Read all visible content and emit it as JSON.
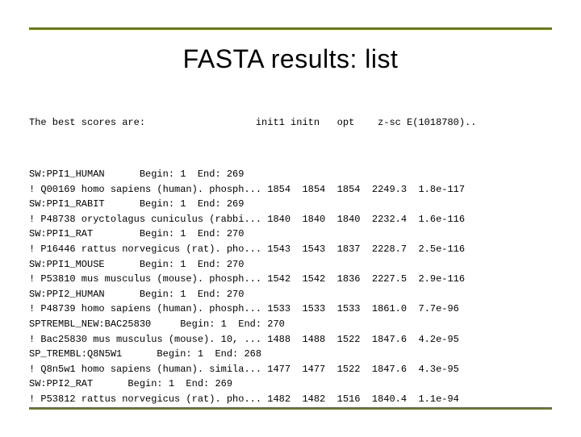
{
  "title": "FASTA results: list",
  "header_line": "The best scores are:                   init1 initn   opt    z-sc E(1018780)..",
  "entries": [
    {
      "seq_line": "SW:PPI1_HUMAN      Begin: 1  End: 269",
      "data_line": "! Q00169 homo sapiens (human). phosph... 1854  1854  1854  2249.3  1.8e-117"
    },
    {
      "seq_line": "SW:PPI1_RABIT      Begin: 1  End: 269",
      "data_line": "! P48738 oryctolagus cuniculus (rabbi... 1840  1840  1840  2232.4  1.6e-116"
    },
    {
      "seq_line": "SW:PPI1_RAT        Begin: 1  End: 270",
      "data_line": "! P16446 rattus norvegicus (rat). pho... 1543  1543  1837  2228.7  2.5e-116"
    },
    {
      "seq_line": "SW:PPI1_MOUSE      Begin: 1  End: 270",
      "data_line": "! P53810 mus musculus (mouse). phosph... 1542  1542  1836  2227.5  2.9e-116"
    },
    {
      "seq_line": "SW:PPI2_HUMAN      Begin: 1  End: 270",
      "data_line": "! P48739 homo sapiens (human). phosph... 1533  1533  1533  1861.0  7.7e-96"
    },
    {
      "seq_line": "SPTREMBL_NEW:BAC25830     Begin: 1  End: 270",
      "data_line": "! Bac25830 mus musculus (mouse). 10, ... 1488  1488  1522  1847.6  4.2e-95"
    },
    {
      "seq_line": "SP_TREMBL:Q8N5W1      Begin: 1  End: 268",
      "data_line": "! Q8n5w1 homo sapiens (human). simila... 1477  1477  1522  1847.6  4.3e-95"
    },
    {
      "seq_line": "SW:PPI2_RAT      Begin: 1  End: 269",
      "data_line": "! P53812 rattus norvegicus (rat). pho... 1482  1482  1516  1840.4  1.1e-94"
    }
  ]
}
